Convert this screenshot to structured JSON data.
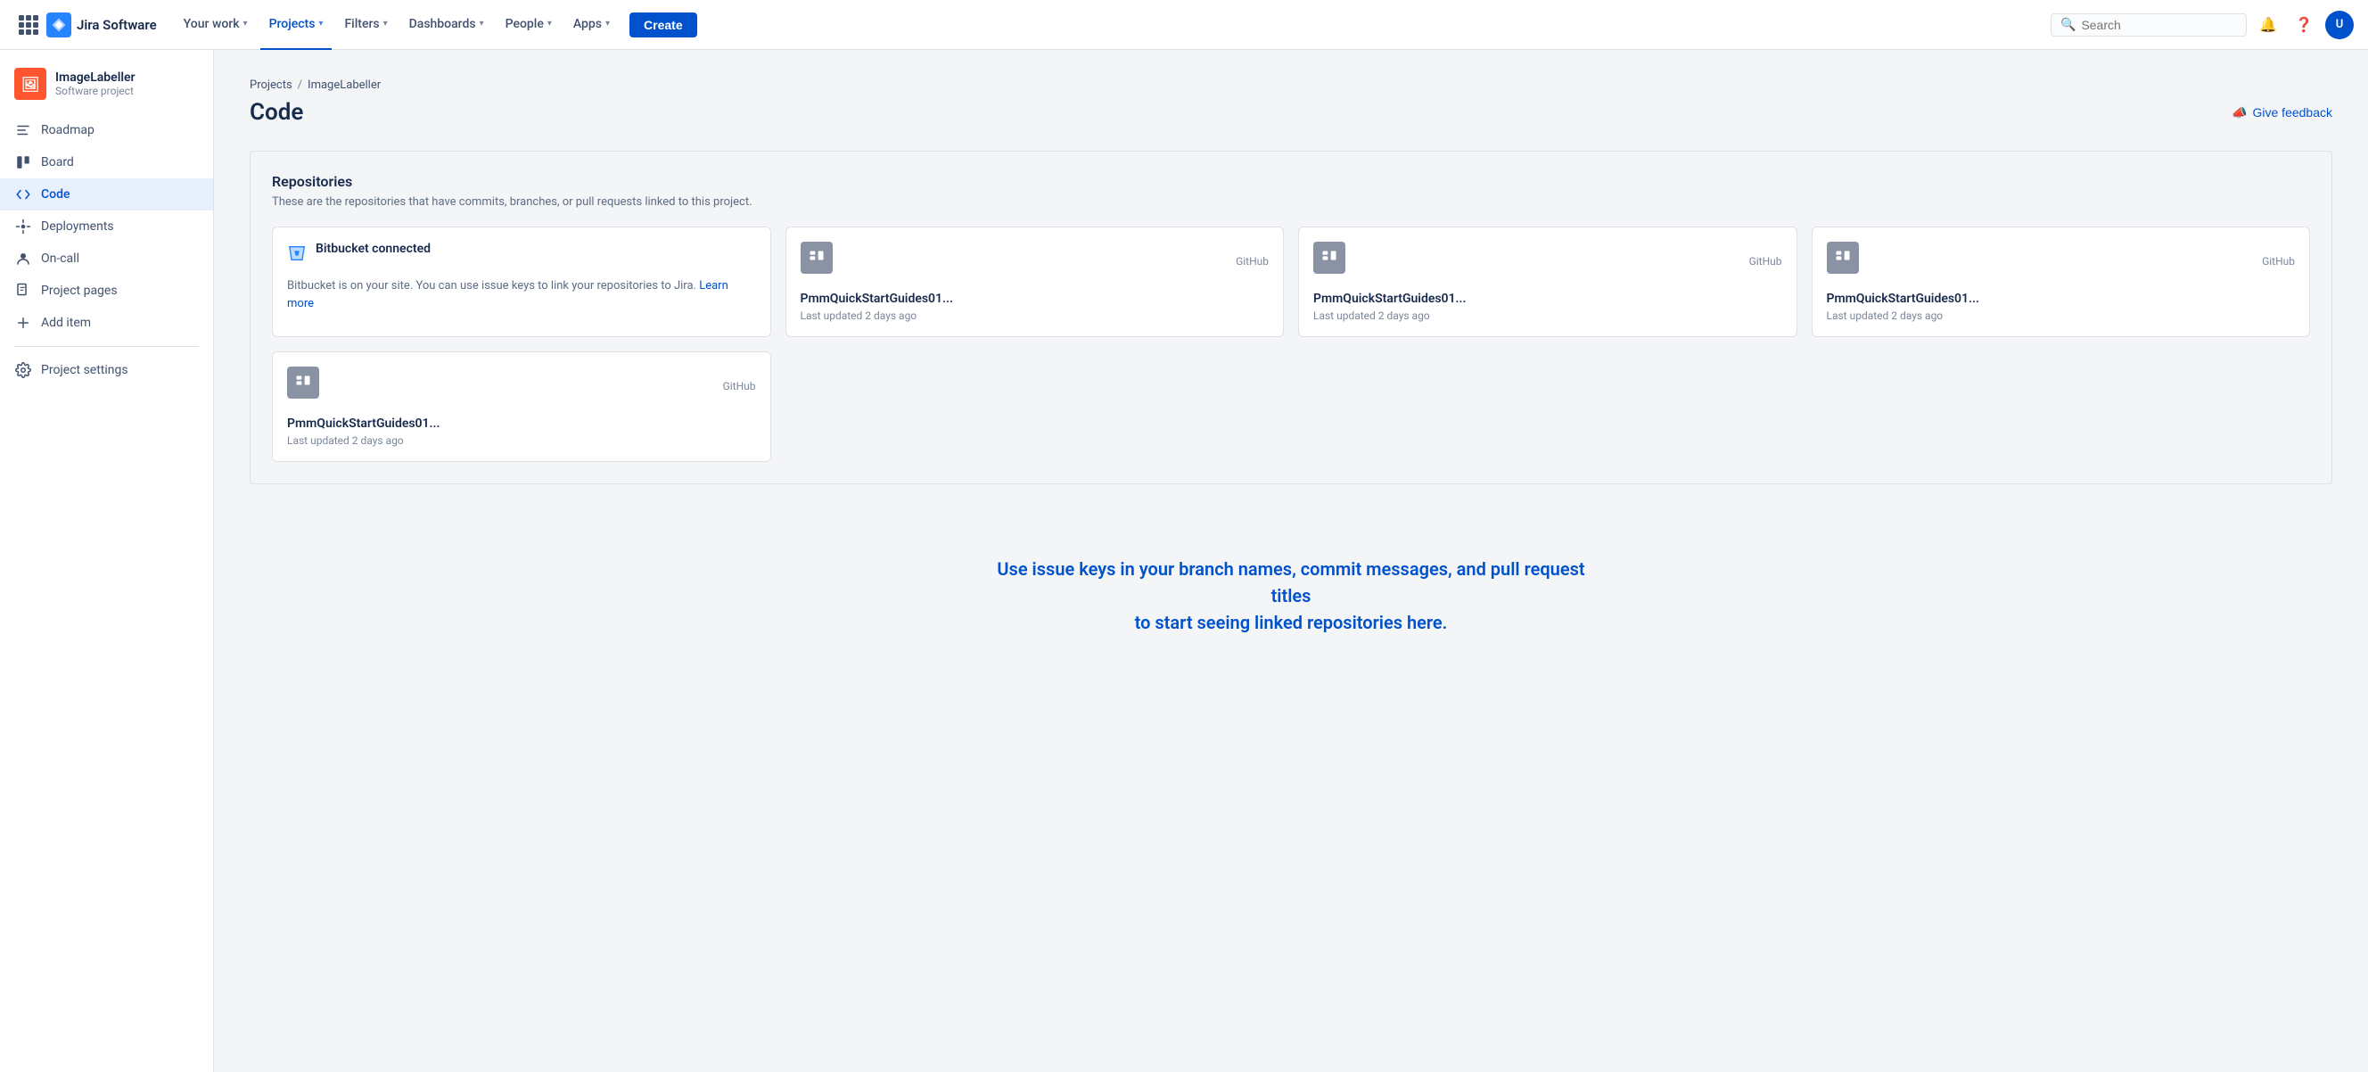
{
  "topnav": {
    "logo_text": "Jira Software",
    "your_work_label": "Your work",
    "projects_label": "Projects",
    "filters_label": "Filters",
    "dashboards_label": "Dashboards",
    "people_label": "People",
    "apps_label": "Apps",
    "create_label": "Create",
    "search_placeholder": "Search"
  },
  "sidebar": {
    "project_name": "ImageLabeller",
    "project_type": "Software project",
    "items": [
      {
        "id": "roadmap",
        "label": "Roadmap"
      },
      {
        "id": "board",
        "label": "Board"
      },
      {
        "id": "code",
        "label": "Code"
      },
      {
        "id": "deployments",
        "label": "Deployments"
      },
      {
        "id": "on-call",
        "label": "On-call"
      },
      {
        "id": "project-pages",
        "label": "Project pages"
      },
      {
        "id": "add-item",
        "label": "Add item"
      },
      {
        "id": "project-settings",
        "label": "Project settings"
      }
    ]
  },
  "breadcrumb": {
    "projects_label": "Projects",
    "project_label": "ImageLabeller"
  },
  "page": {
    "title": "Code",
    "feedback_label": "Give feedback"
  },
  "repositories": {
    "section_title": "Repositories",
    "section_desc": "These are the repositories that have commits, branches, or pull requests linked to this project.",
    "cards": [
      {
        "type": "bitbucket",
        "source": "",
        "name": "Bitbucket connected",
        "desc": "Bitbucket is on your site. You can use issue keys to link your repositories to Jira.",
        "learn_more": "Learn more",
        "updated": ""
      },
      {
        "type": "github",
        "source": "GitHub",
        "name": "PmmQuickStartGuides01...",
        "updated": "Last updated 2 days ago"
      },
      {
        "type": "github",
        "source": "GitHub",
        "name": "PmmQuickStartGuides01...",
        "updated": "Last updated 2 days ago"
      },
      {
        "type": "github",
        "source": "GitHub",
        "name": "PmmQuickStartGuides01...",
        "updated": "Last updated 2 days ago"
      },
      {
        "type": "github",
        "source": "GitHub",
        "name": "PmmQuickStartGuides01...",
        "updated": "Last updated 2 days ago"
      }
    ]
  },
  "cta": {
    "text": "Use issue keys in your branch names, commit messages, and pull request titles\nto start seeing linked repositories here."
  }
}
